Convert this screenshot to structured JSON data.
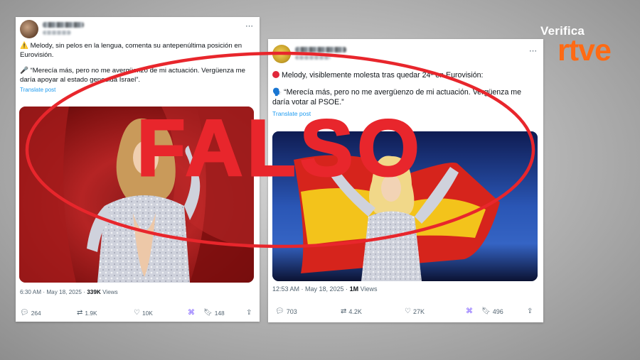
{
  "brand": {
    "verifica": "Verifica",
    "rtve": "rtve",
    "color": "#ff6a13"
  },
  "stamp": {
    "text": "FALSO",
    "color": "#e8262c"
  },
  "tweets": [
    {
      "avatar": "avatar-blurred",
      "line1": "⚠️ Melody, sin pelos en la lengua, comenta su antepenúltima posición en Eurovisión.",
      "line2": "🎤 “Merecía más, pero no me avergüenzo de mi actuación. Vergüenza me daría apoyar al estado genocida Israel”.",
      "translate": "Translate post",
      "time": "6:30 AM · May 18, 2025 ·",
      "views": "339K",
      "views_label": "Views",
      "replies": "264",
      "reposts": "1.9K",
      "likes": "10K",
      "bookmarks": "148"
    },
    {
      "avatar": "avatar-blurred",
      "line1": "Melody, visiblemente molesta tras quedar 24ª en Eurovisión:",
      "line2": "🗣️ “Merecía más, pero no me avergüenzo de mi actuación. Vergüenza me daría votar al PSOE.”",
      "translate": "Translate post",
      "time": "12:53 AM · May 18, 2025 ·",
      "views": "1M",
      "views_label": "Views",
      "replies": "703",
      "reposts": "4.2K",
      "likes": "27K",
      "bookmarks": "496"
    }
  ]
}
